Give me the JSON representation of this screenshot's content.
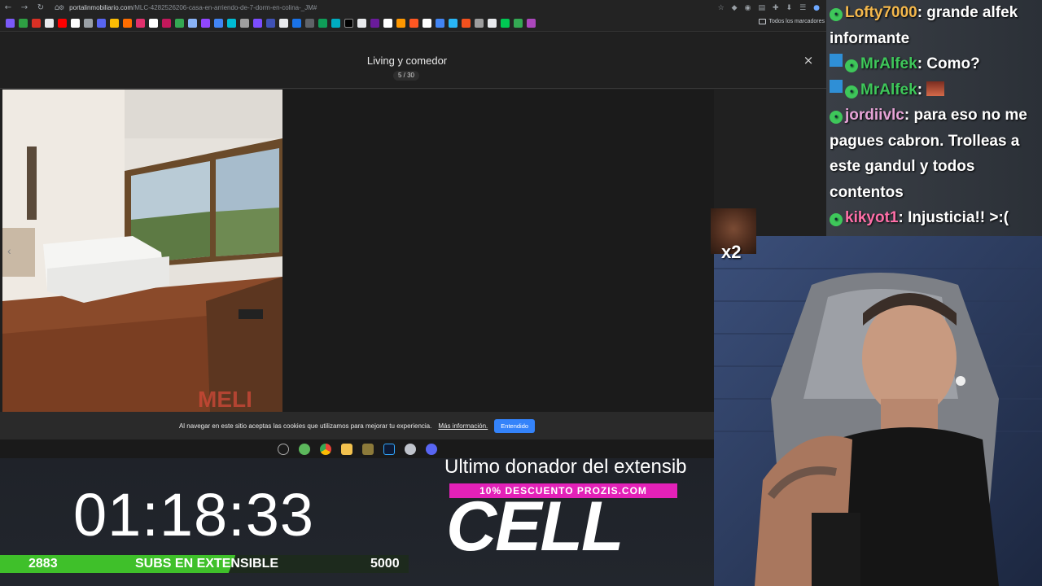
{
  "browser": {
    "url_site": "portalinmobiliario.com",
    "url_path": "/MLC-4282526206-casa-en-arriendo-de-7-dorm-en-colina-_JM#",
    "bookmarks_folder": "Todos los marcadores",
    "nav": [
      "back-icon",
      "forward-icon",
      "reload-icon",
      "home-icon"
    ]
  },
  "gallery": {
    "title": "Living y comedor",
    "counter": "5 / 30",
    "close_label": "×",
    "watermark": "MELI"
  },
  "cookie": {
    "text": "Al navegar en este sitio aceptas las cookies que utilizamos para mejorar tu experiencia.",
    "link": "Más información.",
    "button": "Entendido"
  },
  "chat": {
    "messages": [
      {
        "user": "Lofty7000",
        "text": ": grande alfek informante",
        "color": "#f4b84c"
      },
      {
        "user": "MrAlfek",
        "text": ": Como?",
        "color": "#3ec75a"
      },
      {
        "user": "MrAlfek",
        "text": ":",
        "color": "#3ec75a"
      },
      {
        "user": "jordiivlc",
        "text": ": para eso no me pagues cabron. Trolleas a este gandul y todos contentos",
        "color": "#e6a3d6"
      },
      {
        "user": "kikyot1",
        "text": ": Injusticia!! >:(",
        "color": "#ff6fa8"
      }
    ]
  },
  "emote_popup": {
    "multiplier": "x2"
  },
  "overlay": {
    "donor_label": "Ultimo donador del extensib",
    "promo": "10% DESCUENTO PROZIS.COM",
    "donor_name": "CELL",
    "timer": "01:18:33",
    "subs_count": "2883",
    "subs_label": "SUBS EN EXTENSIBLE",
    "subs_goal": "5000",
    "subs_progress": 0.5766
  },
  "colors": {
    "accent_blue": "#3483fa",
    "subs_green": "#3fc02a",
    "promo_pink": "#e321b8"
  }
}
